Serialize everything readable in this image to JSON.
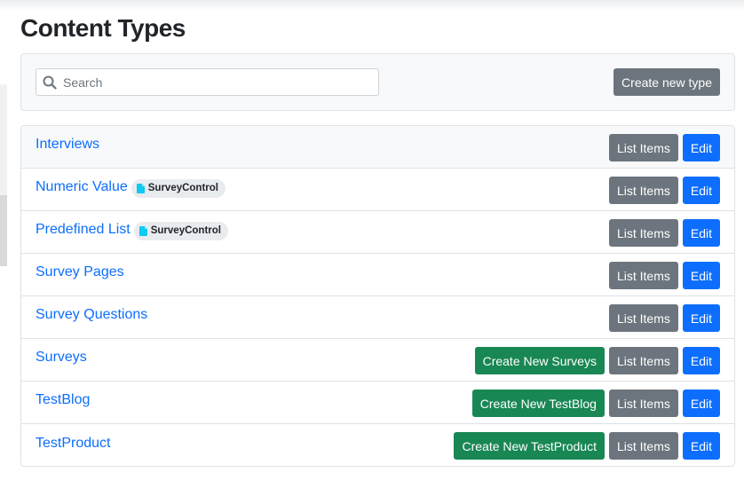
{
  "page": {
    "title": "Content Types"
  },
  "toolbar": {
    "search_placeholder": "Search",
    "search_value": "",
    "create_label": "Create new type"
  },
  "colors": {
    "link": "#0d6efd",
    "secondary": "#6c757d",
    "primary": "#0d6efd",
    "success": "#198754",
    "badge_icon": "#0dcaf0"
  },
  "types": [
    {
      "name": "Interviews",
      "badge": "",
      "create_label": "",
      "list_label": "List Items",
      "edit_label": "Edit"
    },
    {
      "name": "Numeric Value",
      "badge": "SurveyControl",
      "create_label": "",
      "list_label": "List Items",
      "edit_label": "Edit"
    },
    {
      "name": "Predefined List",
      "badge": "SurveyControl",
      "create_label": "",
      "list_label": "List Items",
      "edit_label": "Edit"
    },
    {
      "name": "Survey Pages",
      "badge": "",
      "create_label": "",
      "list_label": "List Items",
      "edit_label": "Edit"
    },
    {
      "name": "Survey Questions",
      "badge": "",
      "create_label": "",
      "list_label": "List Items",
      "edit_label": "Edit"
    },
    {
      "name": "Surveys",
      "badge": "",
      "create_label": "Create New Surveys",
      "list_label": "List Items",
      "edit_label": "Edit"
    },
    {
      "name": "TestBlog",
      "badge": "",
      "create_label": "Create New TestBlog",
      "list_label": "List Items",
      "edit_label": "Edit"
    },
    {
      "name": "TestProduct",
      "badge": "",
      "create_label": "Create New TestProduct",
      "list_label": "List Items",
      "edit_label": "Edit"
    }
  ]
}
